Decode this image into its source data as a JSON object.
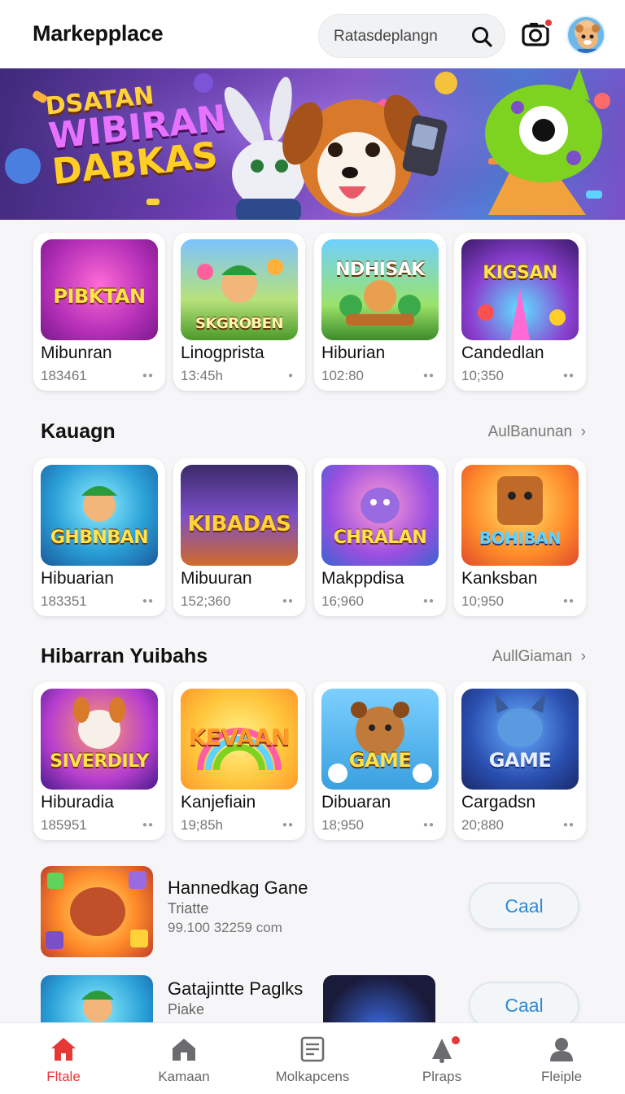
{
  "header": {
    "title": "Markepplace",
    "search_placeholder": "Ratasdeplangn"
  },
  "banner": {
    "line1": "DSATAN",
    "line2": "WIBIRAN",
    "line3": "DABKAS"
  },
  "featured": [
    {
      "name": "Mibunran",
      "count": "183461",
      "art": "PIBKTAN"
    },
    {
      "name": "Linogprista",
      "count": "13:45h",
      "art": "SKGROBEN"
    },
    {
      "name": "Hiburian",
      "count": "102:80",
      "art": "NDHISAK"
    },
    {
      "name": "Candedlan",
      "count": "10;350",
      "art": "KIGSAN"
    }
  ],
  "section1": {
    "title": "Kauagn",
    "see_all": "AulBanunan",
    "items": [
      {
        "name": "Hibuarian",
        "count": "183351",
        "art": "GHBNBAN"
      },
      {
        "name": "Mibuuran",
        "count": "152;360",
        "art": "KIBADAS"
      },
      {
        "name": "Makppdisa",
        "count": "16;960",
        "art": "CHRALAN"
      },
      {
        "name": "Kanksban",
        "count": "10;950",
        "art": "BOHIBAN"
      }
    ]
  },
  "section2": {
    "title": "Hibarran Yuibahs",
    "see_all": "AullGiaman",
    "items": [
      {
        "name": "Hiburadia",
        "count": "185951",
        "art": "SIVERDILY"
      },
      {
        "name": "Kanjefiain",
        "count": "19;85h",
        "art": "KEVAAN"
      },
      {
        "name": "Dibuaran",
        "count": "18;950",
        "art": "GAME"
      },
      {
        "name": "Cargadsn",
        "count": "20;880",
        "art": "GAME"
      }
    ]
  },
  "list": [
    {
      "title": "Hannedkag Gane",
      "sub": "Triatte",
      "meta": "99.100 32259 com",
      "button": "Caal"
    },
    {
      "title": "Gatajintte Paglks",
      "sub": "Piake",
      "meta": "",
      "button": "Caal"
    }
  ],
  "nav": [
    {
      "label": "Fltale",
      "icon": "home-icon"
    },
    {
      "label": "Kamaan",
      "icon": "house-icon"
    },
    {
      "label": "Molkapcens",
      "icon": "document-icon"
    },
    {
      "label": "Plraps",
      "icon": "bell-icon"
    },
    {
      "label": "Fleiple",
      "icon": "profile-icon"
    }
  ],
  "colors": {
    "accent": "#e53935",
    "link": "#2e8ad6"
  }
}
